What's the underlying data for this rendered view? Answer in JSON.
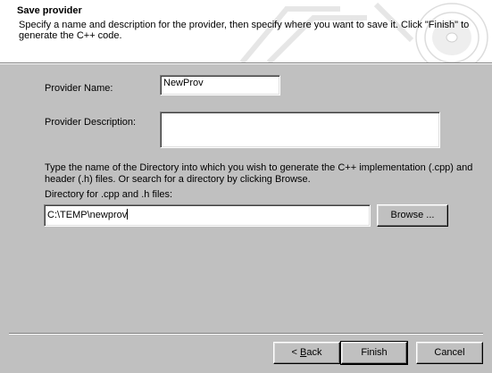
{
  "header": {
    "title": "Save provider",
    "description": "Specify a name and description for the provider, then specify where you want to save it.  Click \"Finish\" to generate the C++ code."
  },
  "form": {
    "provider_name_label": "Provider Name:",
    "provider_name_value": "NewProv",
    "provider_description_label": "Provider Description:",
    "provider_description_value": "",
    "instructions": "Type the name of the Directory into which you wish to generate the C++ implementation (.cpp) and header (.h) files.  Or search for a directory by clicking Browse.",
    "directory_label": "Directory for .cpp and .h files:",
    "directory_value": "C:\\TEMP\\newprov",
    "browse_label": "Browse ..."
  },
  "footer": {
    "back_prefix": "< ",
    "back_accel": "B",
    "back_rest": "ack",
    "finish_label": "Finish",
    "cancel_label": "Cancel"
  },
  "colors": {
    "dialog_bg": "#c0c0c0",
    "header_bg": "#ffffff"
  }
}
